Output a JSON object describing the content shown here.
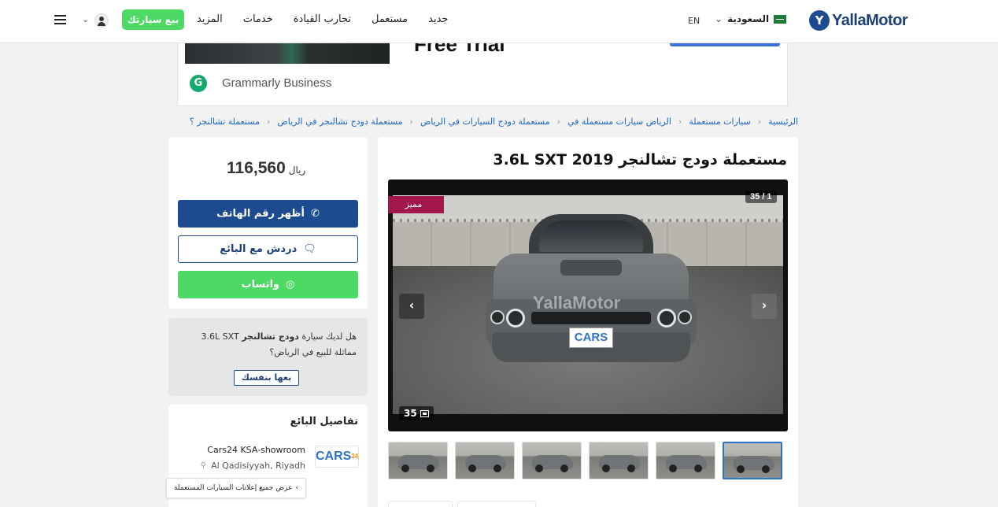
{
  "header": {
    "logo_mark": "Y",
    "logo_text": "YallaMotor",
    "country": "السعودية",
    "country_chevron": "⌄",
    "language": "EN",
    "nav": [
      "جديد",
      "مستعمل",
      "تجارب القيادة",
      "خدمات",
      "المزيد"
    ],
    "sell_button": "بيع سيارتك",
    "user_chevron": "⌄"
  },
  "ad": {
    "headline": "Free Trial",
    "logo_letter": "G",
    "brand": "Grammarly Business"
  },
  "breadcrumb": [
    "الرئيسية",
    "سيارات مستعملة",
    "الرياض سيارات مستعملة في",
    "مستعملة دودج السيارات في الرياض",
    "مستعملة دودج تشالنجر في الرياض",
    "مستعملة تشالنجر ؟"
  ],
  "price_card": {
    "price": "116,560",
    "currency": "ريال",
    "phone_button": "أظهر رقم الهاتف",
    "phone_icon": "✆",
    "chat_button": "دردش مع البائع",
    "chat_icon": "🗨",
    "whatsapp_button": "واتساب",
    "whatsapp_icon": "◎"
  },
  "sell_card": {
    "text_before": "هل لديك سيارة ",
    "text_bold": "دودج تشالنجر",
    "text_after": " 3.6L SXT مماثلة للبيع في الرياض؟",
    "button": "بعها بنفسك"
  },
  "seller": {
    "title": "تفاصيل البائع",
    "logo_text": "CARS",
    "logo_sup": "24",
    "name": "Cars24 KSA-showroom",
    "location": "Al Qadisiyyah, Riyadh",
    "pin_icon": "⚲",
    "view_all": "عرض جميع إعلانات السيارات المستعملة",
    "view_all_chevron": "‹"
  },
  "listing": {
    "title": "مستعملة دودج تشالنجر 2019 3.6L SXT",
    "counter": "35 / 1",
    "badge": "مميز",
    "arrow_left": "‹",
    "arrow_right": "›",
    "photo_count": "35",
    "plate": "CARS",
    "watermark": "YallaMotor"
  },
  "colors": {
    "brand_blue": "#1d4b8f",
    "whatsapp_green": "#4cd964",
    "featured": "#a3184a",
    "link": "#1a66c9"
  }
}
